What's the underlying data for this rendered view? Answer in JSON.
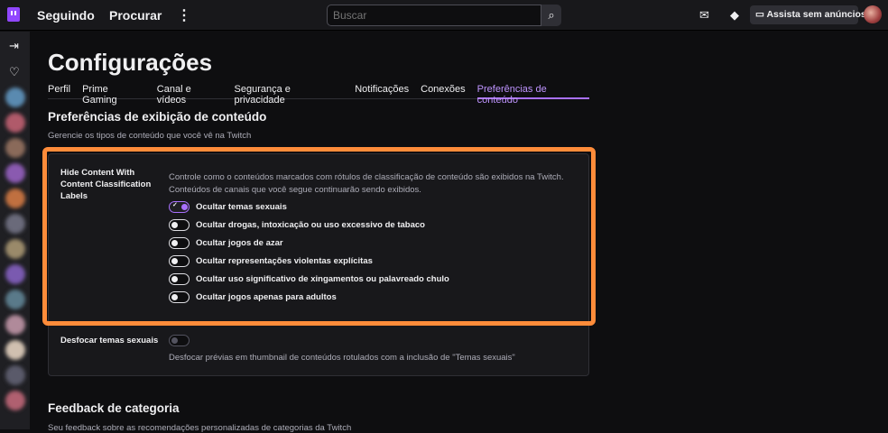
{
  "topbar": {
    "following": "Seguindo",
    "browse": "Procurar",
    "more_icon": "more-vertical-icon",
    "search_placeholder": "Buscar",
    "ad_free": "Assista sem anúncios",
    "accent": "#9147ff"
  },
  "page": {
    "title": "Configurações",
    "tabs": [
      {
        "label": "Perfil"
      },
      {
        "label": "Prime Gaming"
      },
      {
        "label": "Canal e vídeos"
      },
      {
        "label": "Segurança e privacidade"
      },
      {
        "label": "Notificações"
      },
      {
        "label": "Conexões"
      },
      {
        "label": "Preferências de conteúdo",
        "active": true
      }
    ]
  },
  "section": {
    "title": "Preferências de exibição de conteúdo",
    "subtitle": "Gerencie os tipos de conteúdo que você vê na Twitch"
  },
  "ccl": {
    "label": "Hide Content With Content Classification Labels",
    "description": "Controle como o conteúdos marcados com rótulos de classificação de conteúdo são exibidos na Twitch. Conteúdos de canais que você segue continuarão sendo exibidos.",
    "options": [
      {
        "label": "Ocultar temas sexuais",
        "on": true
      },
      {
        "label": "Ocultar drogas, intoxicação ou uso excessivo de tabaco",
        "on": false
      },
      {
        "label": "Ocultar jogos de azar",
        "on": false
      },
      {
        "label": "Ocultar representações violentas explícitas",
        "on": false
      },
      {
        "label": "Ocultar uso significativo de xingamentos ou palavreado chulo",
        "on": false
      },
      {
        "label": "Ocultar jogos apenas para adultos",
        "on": false
      }
    ]
  },
  "blur": {
    "label": "Desfocar temas sexuais",
    "description": "Desfocar prévias em thumbnail de conteúdos rotulados com a inclusão de \"Temas sexuais\"",
    "on": false
  },
  "feedback": {
    "title": "Feedback de categoria",
    "subtitle": "Seu feedback sobre as recomendações personalizadas de categorias da Twitch"
  },
  "highlight_color": "#ff8c3a"
}
